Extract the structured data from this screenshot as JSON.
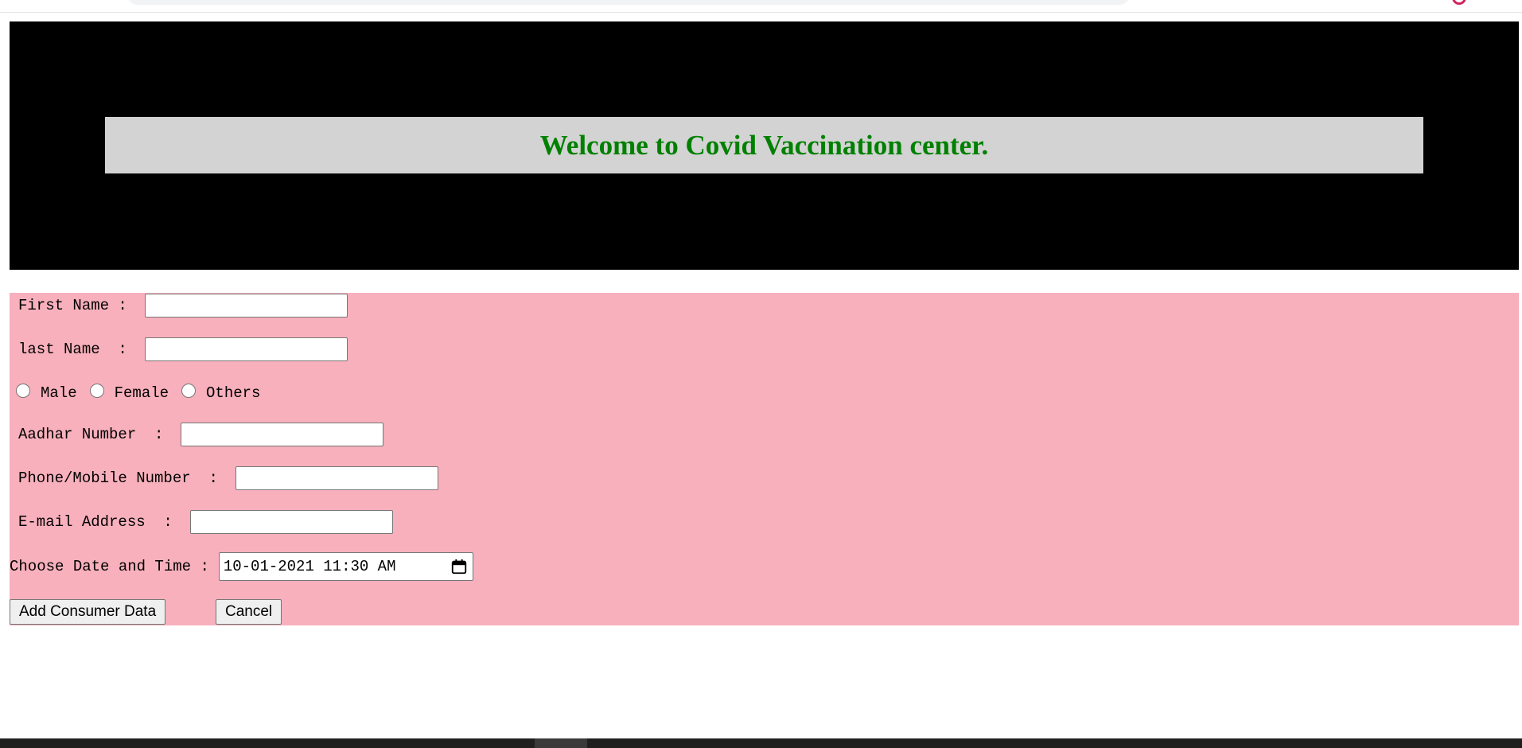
{
  "banner": {
    "title": "Welcome to Covid Vaccination center."
  },
  "form": {
    "first_name_label": "First Name :",
    "first_name_value": "",
    "last_name_label": "last Name  :",
    "last_name_value": "",
    "gender_options": [
      "Male",
      "Female",
      "Others"
    ],
    "aadhar_label": "Aadhar Number  :",
    "aadhar_value": "",
    "phone_label": "Phone/Mobile Number  :",
    "phone_value": "",
    "email_label": "E-mail Address  :",
    "email_value": "",
    "datetime_label": "Choose Date and Time :",
    "datetime_value": "10-01-2021 11:30 AM"
  },
  "buttons": {
    "add_label": "Add Consumer Data",
    "cancel_label": "Cancel"
  },
  "colors": {
    "banner_bg": "#000000",
    "banner_inner_bg": "#d3d3d3",
    "banner_title": "#008000",
    "form_bg": "#f8b0bc"
  },
  "icons": {
    "datetime_picker": "calendar-icon",
    "browser_profile": "profile-icon"
  }
}
